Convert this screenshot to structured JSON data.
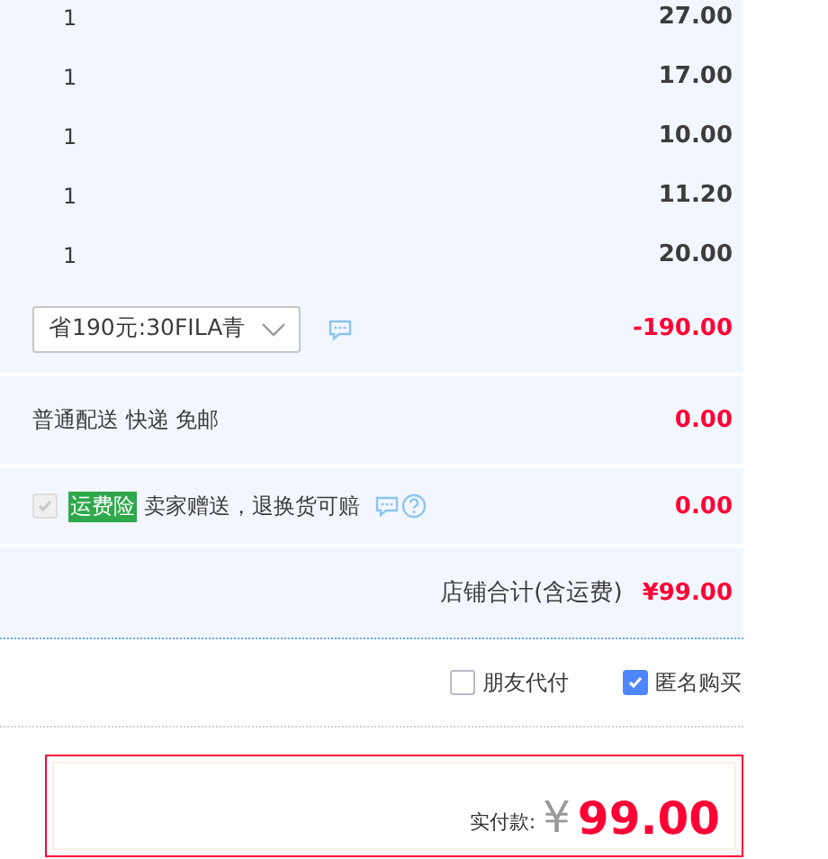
{
  "items": [
    {
      "quantity": "1",
      "price": "27.00"
    },
    {
      "quantity": "1",
      "price": "17.00"
    },
    {
      "quantity": "1",
      "price": "10.00"
    },
    {
      "quantity": "1",
      "price": "11.20"
    },
    {
      "quantity": "1",
      "price": "20.00"
    }
  ],
  "promotion": {
    "value": "省190元:30FILA青",
    "amount": "-190.00"
  },
  "shipping": {
    "label": "普通配送 快递 免邮",
    "amount": "0.00"
  },
  "insurance": {
    "checked": true,
    "disabled": true,
    "badge": "运费险",
    "text": "卖家赠送，退换货可赔",
    "amount": "0.00"
  },
  "shop_total": {
    "label": "店铺合计(含运费)",
    "amount": "¥99.00"
  },
  "options": [
    {
      "label": "朋友代付",
      "checked": false
    },
    {
      "label": "匿名购买",
      "checked": true
    }
  ],
  "payment": {
    "label": "实付款:",
    "currency": "¥",
    "amount": "99.00"
  }
}
